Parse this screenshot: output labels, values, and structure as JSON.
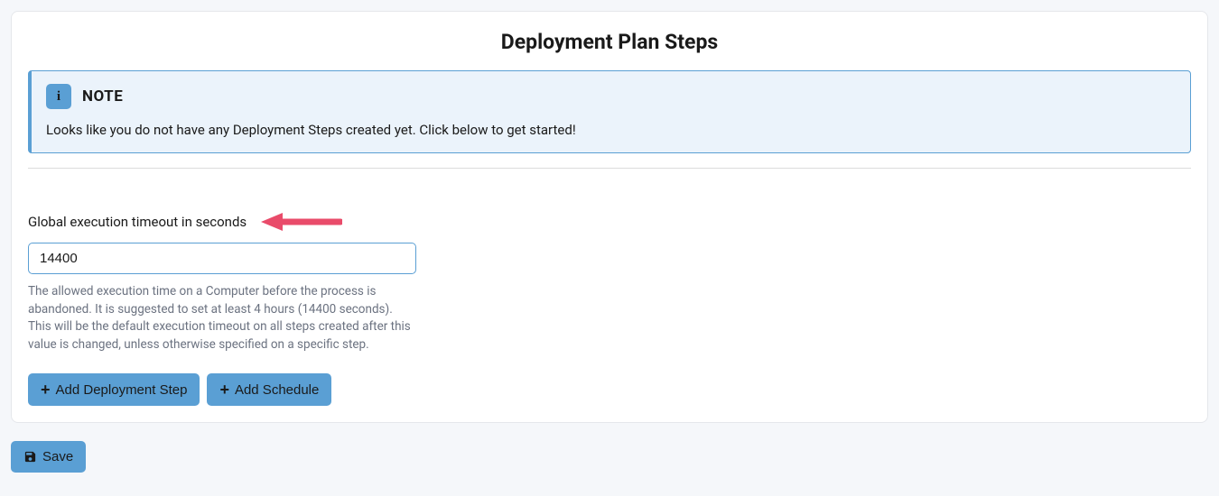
{
  "panel": {
    "title": "Deployment Plan Steps"
  },
  "note": {
    "title": "NOTE",
    "body": "Looks like you do not have any Deployment Steps created yet. Click below to get started!"
  },
  "timeout": {
    "label": "Global execution timeout in seconds",
    "value": "14400",
    "help": "The allowed execution time on a Computer before the process is abandoned. It is suggested to set at least 4 hours (14400 seconds). This will be the default execution timeout on all steps created after this value is changed, unless otherwise specified on a specific step."
  },
  "buttons": {
    "add_step": "Add Deployment Step",
    "add_schedule": "Add Schedule",
    "save": "Save"
  },
  "annotation": {
    "arrow_color": "#e94b6a"
  }
}
